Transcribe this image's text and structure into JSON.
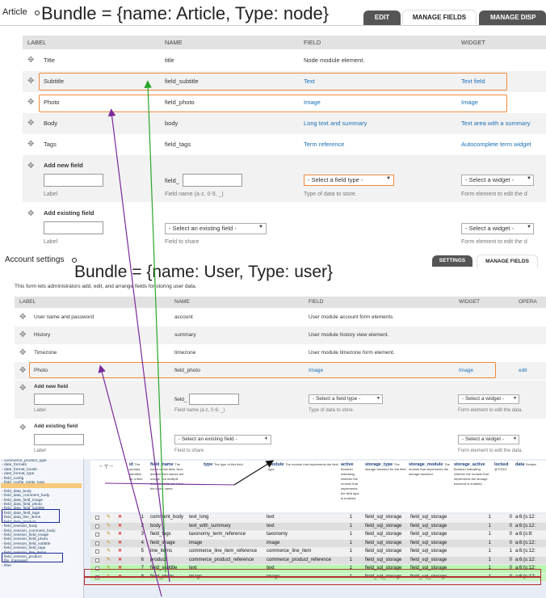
{
  "article": {
    "label": "Article",
    "bundle_title": "Bundle = {name: Article, Type: node}",
    "tabs": [
      "EDIT",
      "MANAGE FIELDS",
      "MANAGE DISP"
    ],
    "headers": [
      "LABEL",
      "NAME",
      "FIELD",
      "WIDGET"
    ],
    "rows": [
      {
        "label": "Title",
        "name": "title",
        "field": "Node module element.",
        "widget": ""
      },
      {
        "label": "Subtitle",
        "name": "field_subtitle",
        "field": "Text",
        "widget": "Text field"
      },
      {
        "label": "Photo",
        "name": "field_photo",
        "field": "Image",
        "widget": "Image"
      },
      {
        "label": "Body",
        "name": "body",
        "field": "Long text and summary",
        "widget": "Text area with a summary"
      },
      {
        "label": "Tags",
        "name": "field_tags",
        "field": "Term reference",
        "widget": "Autocomplete term widget"
      }
    ],
    "add_new": {
      "title": "Add new field",
      "label_caption": "Label",
      "prefix": "field_",
      "name_caption": "Field name (a-z, 0-9, _)",
      "type_select": "- Select a field type -",
      "type_caption": "Type of data to store.",
      "widget_select": "- Select a widget -",
      "widget_caption": "Form element to edit the d"
    },
    "add_existing": {
      "title": "Add existing field",
      "label_caption": "Label",
      "existing_select": "- Select an existing field -",
      "existing_caption": "Field to share",
      "widget_select": "- Select a widget -",
      "widget_caption": "Form element to edit the d"
    }
  },
  "user": {
    "label": "Account settings",
    "bundle_title": "Bundle = {name: User, Type: user}",
    "tabs": [
      "SETTINGS",
      "MANAGE FIELDS"
    ],
    "description": "This form lets administrators add, edit, and arrange fields for storing user data.",
    "headers": [
      "LABEL",
      "NAME",
      "FIELD",
      "WIDGET",
      "OPERA"
    ],
    "rows": [
      {
        "label": "User name and password",
        "name": "account",
        "field": "User module account form elements",
        "widget": "",
        "op": ""
      },
      {
        "label": "History",
        "name": "summary",
        "field": "User module history view element.",
        "widget": "",
        "op": ""
      },
      {
        "label": "Timezone",
        "name": "timezone",
        "field": "User module timezone form element.",
        "widget": "",
        "op": ""
      },
      {
        "label": "Photo",
        "name": "field_photo",
        "field": "Image",
        "widget": "Image",
        "op": "edit"
      }
    ],
    "add_new": {
      "title": "Add new field",
      "label_caption": "Label",
      "prefix": "field_",
      "name_caption": "Field name (a-z, 0-9, _)",
      "type_select": "- Select a field type -",
      "type_caption": "Type of data to store.",
      "widget_select": "- Select a widget -",
      "widget_caption": "Form element to edit the data."
    },
    "add_existing": {
      "title": "Add existing field",
      "label_caption": "Label",
      "existing_select": "- Select an existing field -",
      "existing_caption": "Field to share",
      "widget_select": "- Select a widget -",
      "widget_caption": "Form element to edit the data."
    }
  },
  "db": {
    "sidebar": [
      "commerce_product_type",
      "date_formats",
      "date_format_locale",
      "date_format_type",
      "field_config",
      "field_config_entity_type",
      "field_config_instance",
      "field_data_body",
      "field_data_comment_body",
      "field_data_field_image",
      "field_data_field_photo",
      "field_data_field_subtitle",
      "field_data_field_tags",
      "field_data_line_items",
      "field_data_product",
      "field_revision_body",
      "field_revision_comment_body",
      "field_revision_field_image",
      "field_revision_field_photo",
      "field_revision_field_subtitle",
      "field_revision_field_tags",
      "field_revision_line_items",
      "field_revision_product",
      "file_managed",
      "filter"
    ],
    "columns": [
      {
        "name": "id",
        "desc": "The primary identifier for a field"
      },
      {
        "name": "field_name",
        "desc": "The name of this field. Non-deleted field names are unique, but multiple deleted fields can have the same name."
      },
      {
        "name": "type",
        "desc": "The type of this field."
      },
      {
        "name": "module",
        "desc": "The module that implements the field type."
      },
      {
        "name": "active",
        "desc": "Boolean indicating whether the module that implements the field type is enabled."
      },
      {
        "name": "storage_type",
        "desc": "The storage backend for the field."
      },
      {
        "name": "storage_module",
        "desc": "The module that implements the storage backend."
      },
      {
        "name": "storage_active",
        "desc": "Boolean indicating whether the module that implements the storage backend is enabled."
      },
      {
        "name": "locked",
        "desc": "@TODO"
      },
      {
        "name": "data",
        "desc": "Serializ"
      }
    ],
    "rows": [
      {
        "id": "1",
        "field_name": "comment_body",
        "type": "text_long",
        "module": "text",
        "active": "1",
        "storage_type": "field_sql_storage",
        "storage_module": "field_sql_storage",
        "storage_active": "1",
        "locked": "0",
        "data": "a:6:{s:12:"
      },
      {
        "id": "2",
        "field_name": "body",
        "type": "text_with_summary",
        "module": "text",
        "active": "1",
        "storage_type": "field_sql_storage",
        "storage_module": "field_sql_storage",
        "storage_active": "1",
        "locked": "0",
        "data": "a:6:{s:12:"
      },
      {
        "id": "3",
        "field_name": "field_tags",
        "type": "taxonomy_term_reference",
        "module": "taxonomy",
        "active": "1",
        "storage_type": "field_sql_storage",
        "storage_module": "field_sql_storage",
        "storage_active": "1",
        "locked": "0",
        "data": "a:6:{s:8:"
      },
      {
        "id": "4",
        "field_name": "field_image",
        "type": "image",
        "module": "image",
        "active": "1",
        "storage_type": "field_sql_storage",
        "storage_module": "field_sql_storage",
        "storage_active": "1",
        "locked": "0",
        "data": "a:6:{s:12:"
      },
      {
        "id": "5",
        "field_name": "line_items",
        "type": "commerce_line_item_reference",
        "module": "commerce_line_item",
        "active": "1",
        "storage_type": "field_sql_storage",
        "storage_module": "field_sql_storage",
        "storage_active": "1",
        "locked": "1",
        "data": "a:6:{s:12:"
      },
      {
        "id": "6",
        "field_name": "product",
        "type": "commerce_product_reference",
        "module": "commerce_product_reference",
        "active": "1",
        "storage_type": "field_sql_storage",
        "storage_module": "field_sql_storage",
        "storage_active": "1",
        "locked": "0",
        "data": "a:6:{s:12:"
      },
      {
        "id": "7",
        "field_name": "field_subtitle",
        "type": "text",
        "module": "text",
        "active": "1",
        "storage_type": "field_sql_storage",
        "storage_module": "field_sql_storage",
        "storage_active": "1",
        "locked": "0",
        "data": "a:6:{s:12:"
      },
      {
        "id": "8",
        "field_name": "field_photo",
        "type": "image",
        "module": "image",
        "active": "1",
        "storage_type": "field_sql_storage",
        "storage_module": "field_sql_storage",
        "storage_active": "1",
        "locked": "0",
        "data": "a:6:{s:12:"
      }
    ]
  },
  "colors": {
    "accent_orange": "#f08a3c",
    "arrow_green": "#2aa52a",
    "arrow_purple": "#7a2a9a",
    "link_blue": "#1a6fb5"
  }
}
